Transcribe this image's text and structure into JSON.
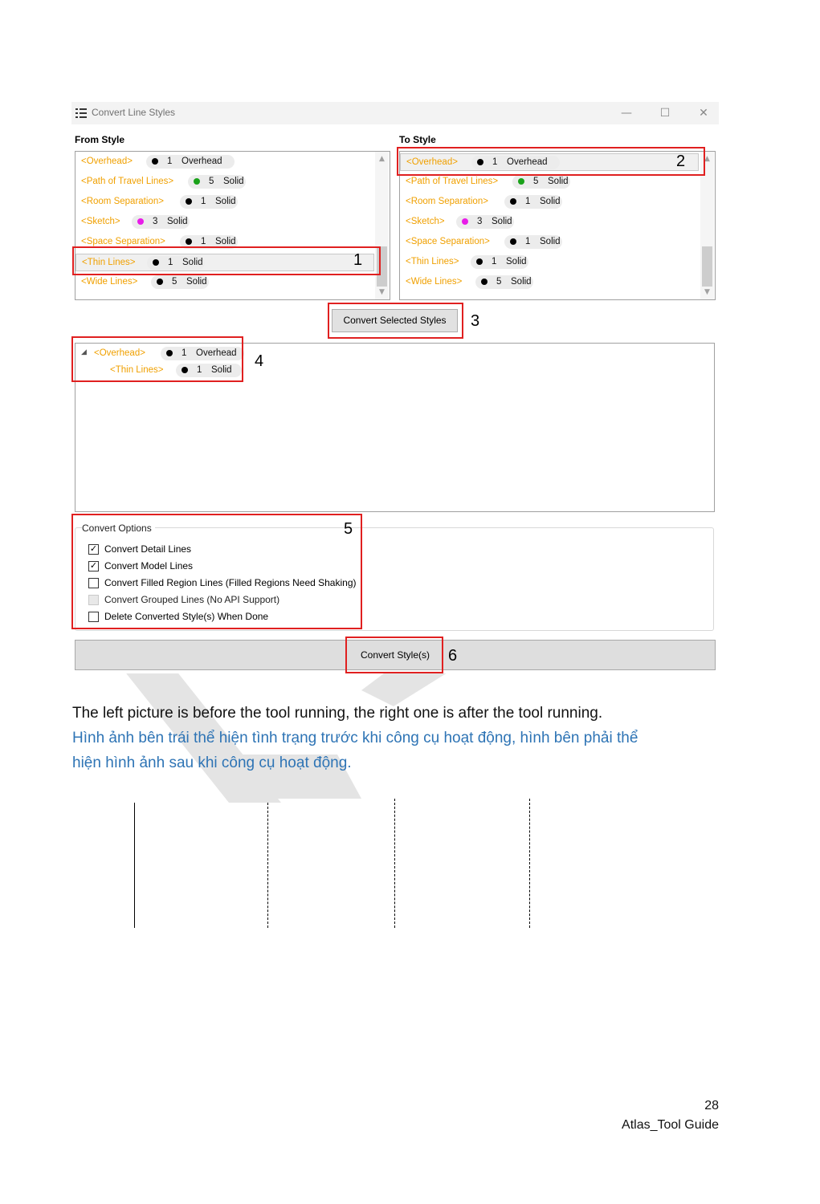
{
  "window": {
    "title": "Convert Line Styles",
    "controls": {
      "minimize": "—",
      "maximize": "☐",
      "close": "✕"
    }
  },
  "from_style": {
    "label": "From Style",
    "items": [
      {
        "name": "<Overhead>",
        "dot_color": "#000000",
        "weight": "1",
        "pattern": "Overhead"
      },
      {
        "name": "<Path of Travel Lines>",
        "dot_color": "#1aa21a",
        "weight": "5",
        "pattern": "Solid"
      },
      {
        "name": "<Room Separation>",
        "dot_color": "#000000",
        "weight": "1",
        "pattern": "Solid"
      },
      {
        "name": "<Sketch>",
        "dot_color": "#e81ce8",
        "weight": "3",
        "pattern": "Solid"
      },
      {
        "name": "<Space Separation>",
        "dot_color": "#000000",
        "weight": "1",
        "pattern": "Solid"
      },
      {
        "name": "<Thin Lines>",
        "dot_color": "#000000",
        "weight": "1",
        "pattern": "Solid"
      },
      {
        "name": "<Wide Lines>",
        "dot_color": "#000000",
        "weight": "5",
        "pattern": "Solid"
      }
    ]
  },
  "to_style": {
    "label": "To Style",
    "items": [
      {
        "name": "<Overhead>",
        "dot_color": "#000000",
        "weight": "1",
        "pattern": "Overhead"
      },
      {
        "name": "<Path of Travel Lines>",
        "dot_color": "#1aa21a",
        "weight": "5",
        "pattern": "Solid"
      },
      {
        "name": "<Room Separation>",
        "dot_color": "#000000",
        "weight": "1",
        "pattern": "Solid"
      },
      {
        "name": "<Sketch>",
        "dot_color": "#e81ce8",
        "weight": "3",
        "pattern": "Solid"
      },
      {
        "name": "<Space Separation>",
        "dot_color": "#000000",
        "weight": "1",
        "pattern": "Solid"
      },
      {
        "name": "<Thin Lines>",
        "dot_color": "#000000",
        "weight": "1",
        "pattern": "Solid"
      },
      {
        "name": "<Wide Lines>",
        "dot_color": "#000000",
        "weight": "5",
        "pattern": "Solid"
      }
    ]
  },
  "convert_selected_label": "Convert Selected Styles",
  "mapping_tree": {
    "expander": "◢",
    "parent": {
      "name": "<Overhead>",
      "dot_color": "#000000",
      "weight": "1",
      "pattern": "Overhead"
    },
    "child": {
      "name": "<Thin Lines>",
      "dot_color": "#000000",
      "weight": "1",
      "pattern": "Solid"
    }
  },
  "options": {
    "title": "Convert Options",
    "items": [
      {
        "label": "Convert Detail Lines",
        "checked": "✓",
        "enabled": true
      },
      {
        "label": "Convert Model Lines",
        "checked": "✓",
        "enabled": true
      },
      {
        "label": "Convert Filled Region Lines (Filled Regions Need Shaking)",
        "checked": "",
        "enabled": true
      },
      {
        "label": "Convert Grouped Lines (No API Support)",
        "checked": "",
        "enabled": false
      },
      {
        "label": "Delete Converted Style(s) When Done",
        "checked": "",
        "enabled": true
      }
    ]
  },
  "convert_styles_label": "Convert Style(s)",
  "callouts": [
    "1",
    "2",
    "3",
    "4",
    "5",
    "6"
  ],
  "captions": {
    "english": "The left picture is before the tool running, the right one is after the tool running.",
    "vietnamese_line1": "Hình ảnh bên trái thể hiện tình trạng trước khi công cụ hoạt động, hình bên phải thể",
    "vietnamese_line2": "hiện hình ảnh sau khi công cụ hoạt động."
  },
  "colors": {
    "style_name": "#f0a000",
    "callout_box": "#e02020",
    "vietnamese_text": "#2e74b5"
  },
  "footer": {
    "page_number": "28",
    "doc_title": "Atlas_Tool Guide"
  }
}
